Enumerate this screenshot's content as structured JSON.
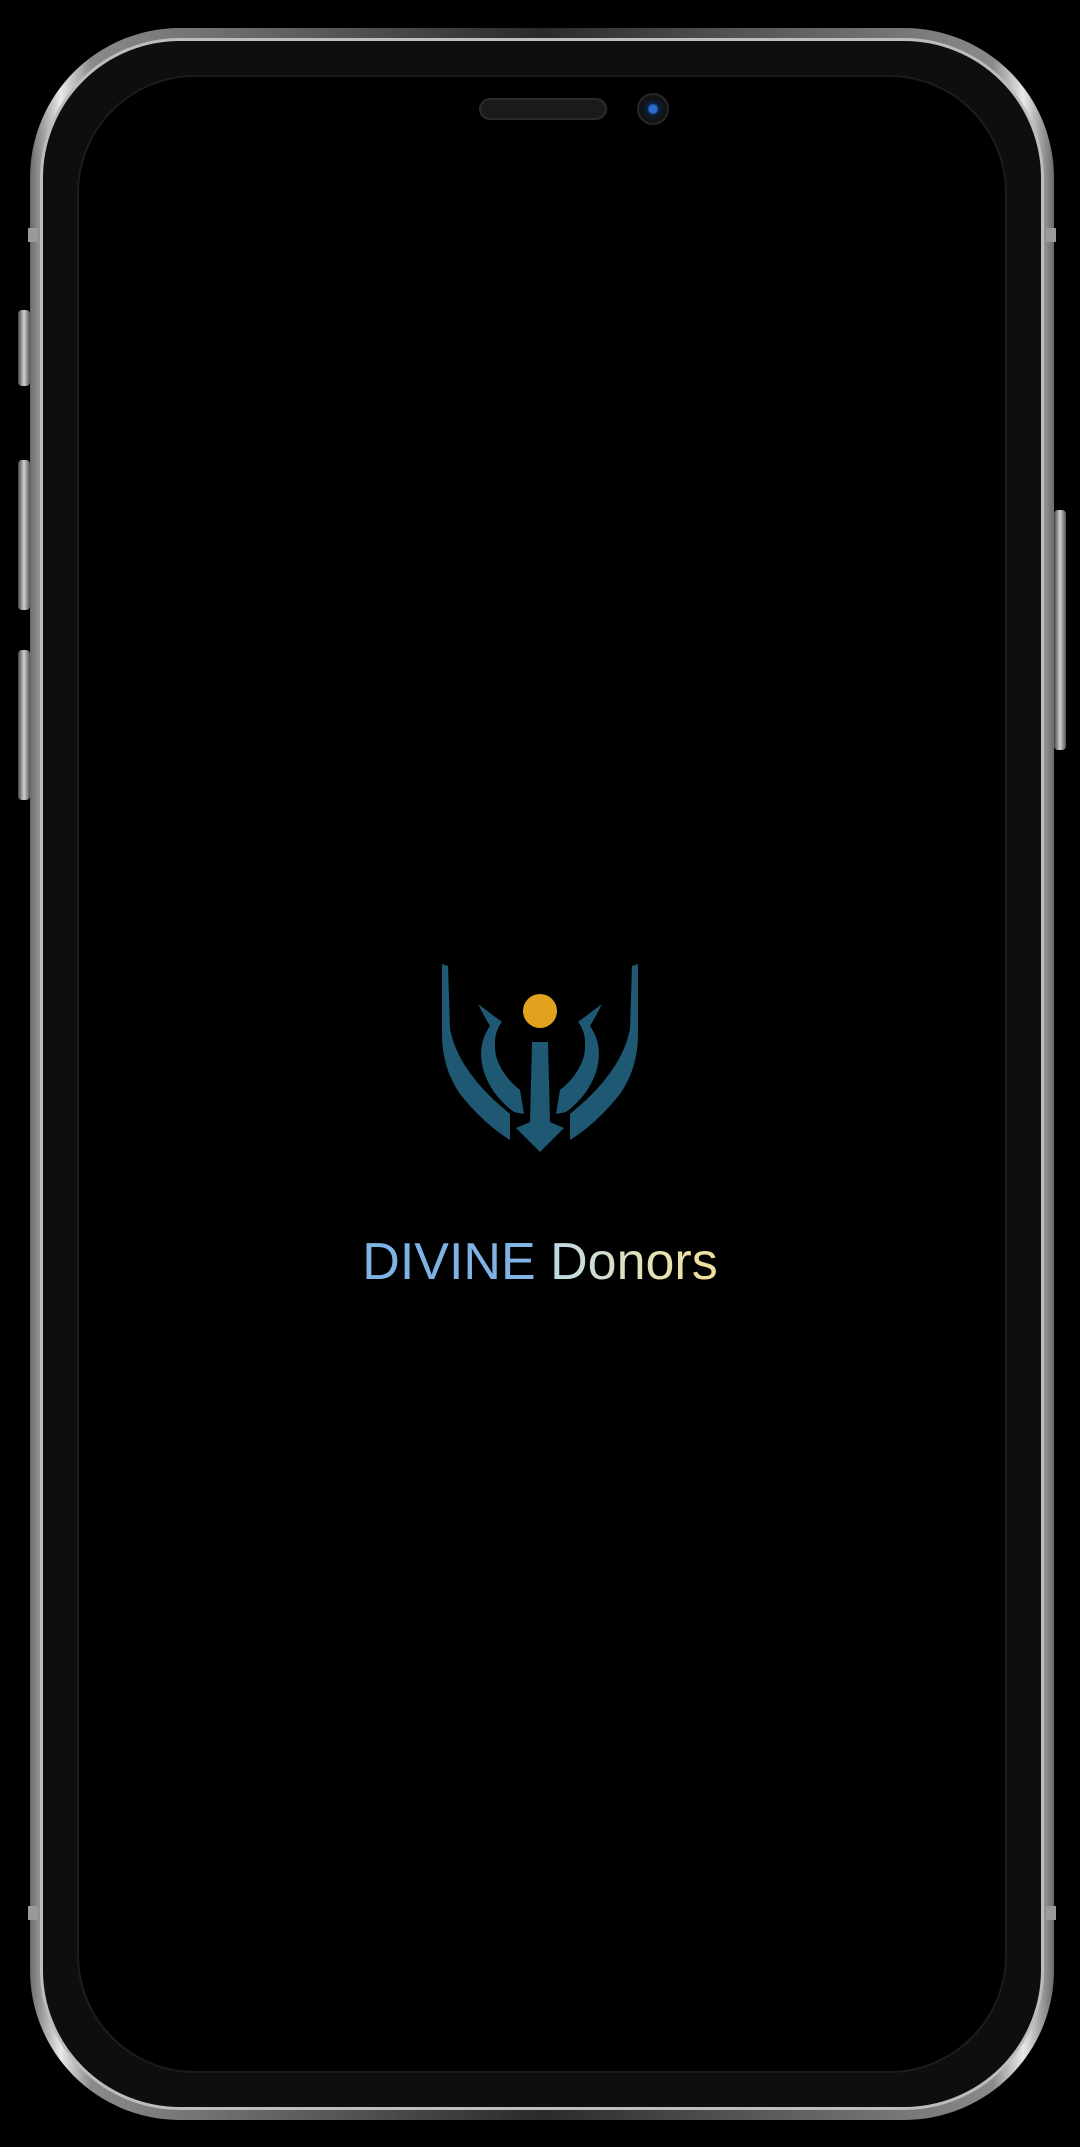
{
  "app": {
    "brand_word_1": "DIVINE",
    "brand_word_2": "Donors"
  },
  "logo": {
    "icon": "hands-holding-sun-icon",
    "hand_color": "#1e5873",
    "sun_color": "#e3a21e"
  },
  "colors": {
    "background": "#000000",
    "brand_word_1": "#7fb3e6",
    "brand_word_2": "#e6e2b4"
  }
}
